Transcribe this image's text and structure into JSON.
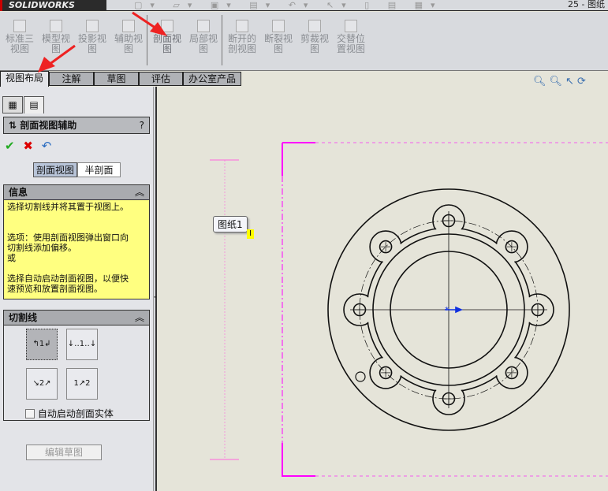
{
  "app": {
    "logo": "SOLIDWORKS",
    "doc_title": "25 - 图纸"
  },
  "ribbon": {
    "buttons": [
      {
        "label": "标准三视图"
      },
      {
        "label": "模型视图"
      },
      {
        "label": "投影视图"
      },
      {
        "label": "辅助视图"
      },
      {
        "label": "剖面视图"
      },
      {
        "label": "局部视图"
      },
      {
        "label": "断开的剖视图"
      },
      {
        "label": "断裂视图"
      },
      {
        "label": "剪裁视图"
      },
      {
        "label": "交替位置视图"
      }
    ]
  },
  "tabs": [
    {
      "label": "视图布局"
    },
    {
      "label": "注解"
    },
    {
      "label": "草图"
    },
    {
      "label": "评估"
    },
    {
      "label": "办公室产品"
    }
  ],
  "panel": {
    "title": "剖面视图辅助",
    "help": "?",
    "mode_buttons": [
      "剖面视图",
      "半剖面"
    ],
    "info": {
      "title": "信息",
      "text": "选择切割线并将其置于视图上。\n\n\n选项：使用剖面视图弹出窗口向\n切割线添加偏移。\n或\n\n选择自动启动剖面视图，以便快\n速预览和放置剖面视图。"
    },
    "cutting": {
      "title": "切割线",
      "checkbox_label": "自动启动剖面实体",
      "checked": false
    },
    "edit_sketch": "编辑草图"
  },
  "canvas": {
    "tooltip": "图纸1"
  },
  "colors": {
    "sheet_border": "#ff00ff",
    "info_bg": "#ffff80",
    "canvas_bg": "#e5e4d9",
    "annotation": "#ff0000"
  }
}
